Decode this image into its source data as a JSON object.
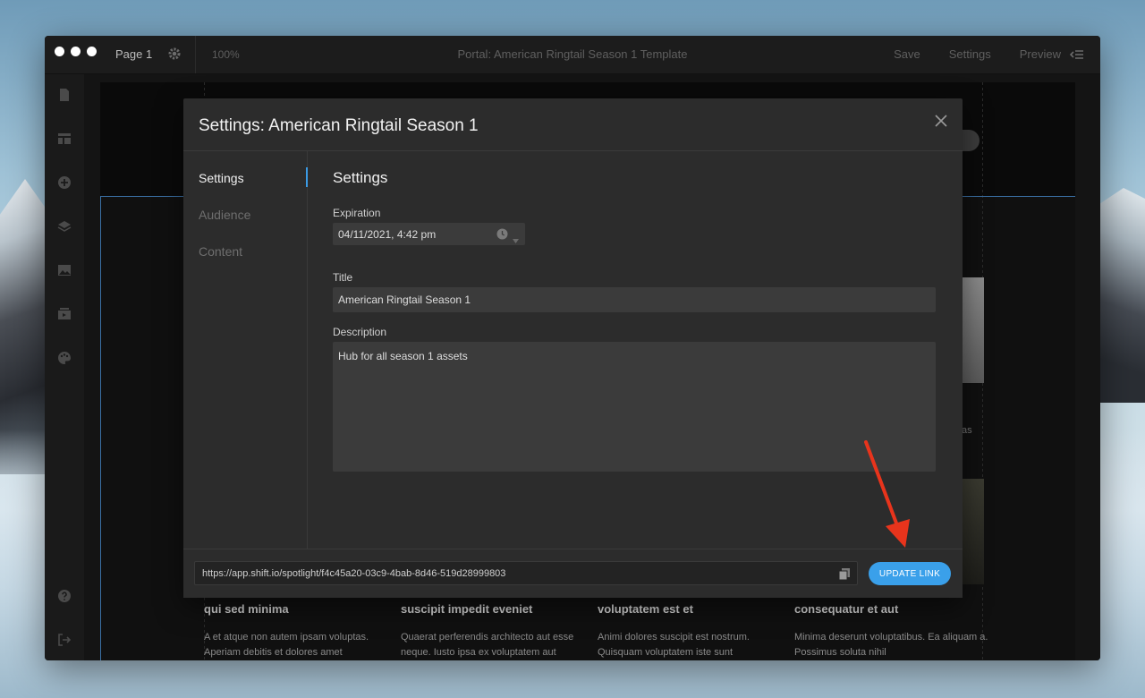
{
  "window": {
    "page_label": "Page 1",
    "zoom": "100%",
    "title": "Portal: American Ringtail Season 1 Template",
    "actions": [
      "Save",
      "Settings",
      "Preview"
    ]
  },
  "modal": {
    "title": "Settings: American Ringtail Season 1",
    "nav": [
      {
        "label": "Settings",
        "active": true
      },
      {
        "label": "Audience",
        "active": false
      },
      {
        "label": "Content",
        "active": false
      }
    ],
    "section_heading": "Settings",
    "expiration": {
      "label": "Expiration",
      "value": "04/11/2021, 4:42 pm"
    },
    "title_field": {
      "label": "Title",
      "value": "American Ringtail Season 1"
    },
    "description": {
      "label": "Description",
      "value": "Hub for all season 1 assets"
    },
    "footer": {
      "link": "https://app.shift.io/spotlight/f4c45a20-03c9-4bab-8d46-519d28999803",
      "button_label": "UPDATE LINK"
    }
  },
  "canvas": {
    "right_fragment": "as",
    "columns": [
      {
        "title": "qui sed minima",
        "text": "A et atque non autem ipsam voluptas. Aperiam debitis et dolores amet"
      },
      {
        "title": "suscipit impedit eveniet",
        "text": "Quaerat perferendis architecto aut esse neque. Iusto ipsa ex voluptatem aut"
      },
      {
        "title": "voluptatem est et",
        "text": "Animi dolores suscipit est nostrum. Quisquam voluptatem iste sunt"
      },
      {
        "title": "consequatur et aut",
        "text": "Minima deserunt voluptatibus. Ea aliquam a. Possimus soluta nihil"
      }
    ]
  },
  "colors": {
    "accent": "#3aa0ea",
    "annotation_arrow": "#e8341c",
    "modal_bg": "#2c2c2c"
  }
}
